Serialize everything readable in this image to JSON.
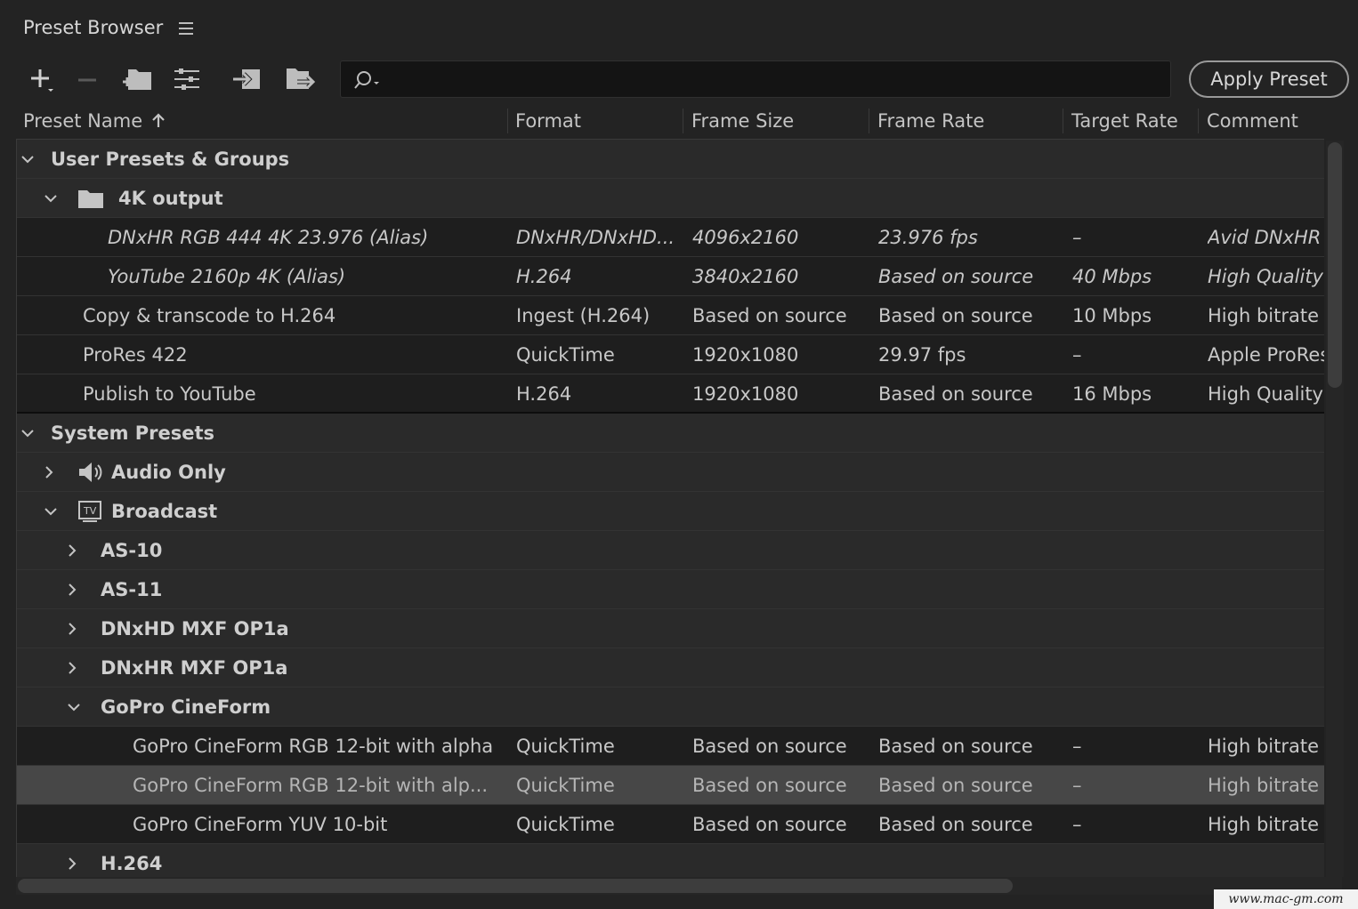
{
  "panel": {
    "title": "Preset Browser"
  },
  "toolbar": {
    "icons": [
      "plus-dropdown-icon",
      "minus-icon",
      "new-group-icon",
      "preset-settings-icon",
      "import-preset-icon",
      "export-preset-icon"
    ],
    "search_placeholder": "",
    "apply_label": "Apply Preset"
  },
  "columns": {
    "name": "Preset Name",
    "format": "Format",
    "frame_size": "Frame Size",
    "frame_rate": "Frame Rate",
    "target_rate": "Target Rate",
    "comment": "Comment"
  },
  "rows": [
    {
      "kind": "group",
      "level": 0,
      "expanded": true,
      "label": "User Presets & Groups"
    },
    {
      "kind": "group",
      "level": 1,
      "expanded": true,
      "icon": "folder-icon",
      "label": "4K output"
    },
    {
      "kind": "preset",
      "level": 2,
      "italic": true,
      "name": "DNxHR RGB 444 4K 23.976 (Alias)",
      "format": "DNxHR/DNxHD...",
      "frame_size": "4096x2160",
      "frame_rate": "23.976 fps",
      "target_rate": "–",
      "comment": "Avid DNxHR"
    },
    {
      "kind": "preset",
      "level": 2,
      "italic": true,
      "name": "YouTube 2160p 4K (Alias)",
      "format": "H.264",
      "frame_size": "3840x2160",
      "frame_rate": "Based on source",
      "target_rate": "40 Mbps",
      "comment": "High Quality"
    },
    {
      "kind": "preset",
      "level": 1,
      "name": "Copy & transcode to H.264",
      "format": "Ingest (H.264)",
      "frame_size": "Based on source",
      "frame_rate": "Based on source",
      "target_rate": "10 Mbps",
      "comment": "High bitrate"
    },
    {
      "kind": "preset",
      "level": 1,
      "name": "ProRes 422",
      "format": "QuickTime",
      "frame_size": "1920x1080",
      "frame_rate": "29.97 fps",
      "target_rate": "–",
      "comment": "Apple ProRes"
    },
    {
      "kind": "preset",
      "level": 1,
      "name": "Publish to YouTube",
      "format": "H.264",
      "frame_size": "1920x1080",
      "frame_rate": "Based on source",
      "target_rate": "16 Mbps",
      "comment": "High Quality"
    },
    {
      "kind": "group",
      "level": 0,
      "expanded": true,
      "label": "System Presets"
    },
    {
      "kind": "group",
      "level": 1,
      "expanded": false,
      "icon": "speaker-icon",
      "label": "Audio Only"
    },
    {
      "kind": "group",
      "level": 1,
      "expanded": true,
      "icon": "tv-icon",
      "label": "Broadcast"
    },
    {
      "kind": "group",
      "level": 2,
      "expanded": false,
      "label": "AS-10"
    },
    {
      "kind": "group",
      "level": 2,
      "expanded": false,
      "label": "AS-11"
    },
    {
      "kind": "group",
      "level": 2,
      "expanded": false,
      "label": "DNxHD MXF OP1a"
    },
    {
      "kind": "group",
      "level": 2,
      "expanded": false,
      "label": "DNxHR MXF OP1a"
    },
    {
      "kind": "group",
      "level": 2,
      "expanded": true,
      "label": "GoPro CineForm"
    },
    {
      "kind": "preset",
      "level": 3,
      "name": "GoPro CineForm RGB 12-bit with alpha",
      "format": "QuickTime",
      "frame_size": "Based on source",
      "frame_rate": "Based on source",
      "target_rate": "–",
      "comment": "High bitrate"
    },
    {
      "kind": "preset",
      "level": 3,
      "selected": true,
      "name": "GoPro CineForm RGB 12-bit with alp...",
      "format": "QuickTime",
      "frame_size": "Based on source",
      "frame_rate": "Based on source",
      "target_rate": "–",
      "comment": "High bitrate"
    },
    {
      "kind": "preset",
      "level": 3,
      "name": "GoPro CineForm YUV 10-bit",
      "format": "QuickTime",
      "frame_size": "Based on source",
      "frame_rate": "Based on source",
      "target_rate": "–",
      "comment": "High bitrate"
    },
    {
      "kind": "group",
      "level": 2,
      "expanded": false,
      "label": "H.264"
    }
  ],
  "watermark": "www.mac-gm.com",
  "colors": {
    "background": "#232323",
    "selected_row": "#474747",
    "preset_row": "#1e1e1e"
  }
}
